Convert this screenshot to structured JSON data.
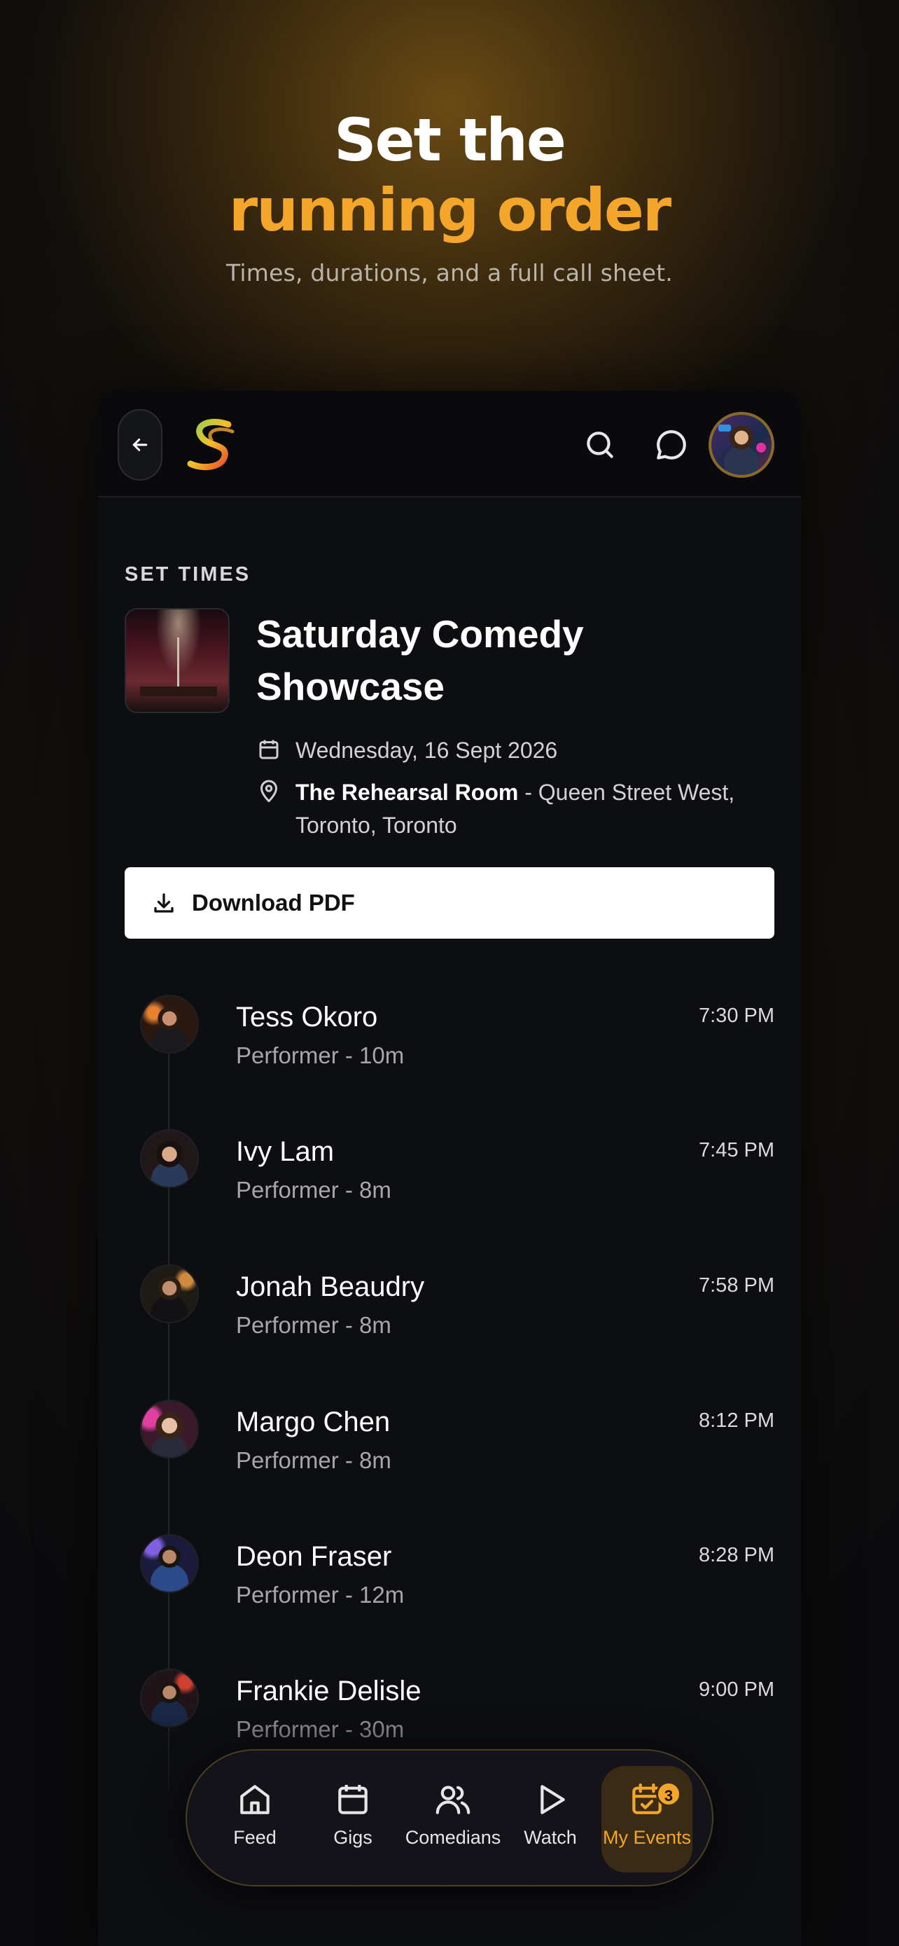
{
  "hero": {
    "line1": "Set the",
    "line2": "running order",
    "subtitle": "Times, durations, and a full call sheet."
  },
  "topbar": {
    "icons": [
      "back-arrow-icon",
      "app-logo",
      "search-icon",
      "chat-icon",
      "bell-icon",
      "profile-avatar"
    ]
  },
  "section_label": "SET TIMES",
  "event": {
    "title": "Saturday Comedy Showcase",
    "date": "Wednesday, 16 Sept 2026",
    "venue_name": "The Rehearsal Room",
    "venue_address": " - Queen Street West, Toronto, Toronto"
  },
  "download_button": "Download PDF",
  "lineup": [
    {
      "name": "Tess Okoro",
      "role": "Performer - 10m",
      "time": "7:30 PM"
    },
    {
      "name": "Ivy Lam",
      "role": "Performer - 8m",
      "time": "7:45 PM"
    },
    {
      "name": "Jonah Beaudry",
      "role": "Performer - 8m",
      "time": "7:58 PM"
    },
    {
      "name": "Margo Chen",
      "role": "Performer - 8m",
      "time": "8:12 PM"
    },
    {
      "name": "Deon Fraser",
      "role": "Performer - 12m",
      "time": "8:28 PM"
    },
    {
      "name": "Frankie Delisle",
      "role": "Performer - 30m",
      "time": "9:00 PM"
    }
  ],
  "tabs": [
    {
      "label": "Feed",
      "icon": "home-icon"
    },
    {
      "label": "Gigs",
      "icon": "calendar-icon"
    },
    {
      "label": "Comedians",
      "icon": "users-icon"
    },
    {
      "label": "Watch",
      "icon": "play-icon"
    },
    {
      "label": "My Events",
      "icon": "calendar-check-icon",
      "badge": "3",
      "active": true
    }
  ],
  "colors": {
    "accent": "#f4a62a",
    "background": "#0d0e12",
    "text_muted": "#a6a6ac"
  }
}
